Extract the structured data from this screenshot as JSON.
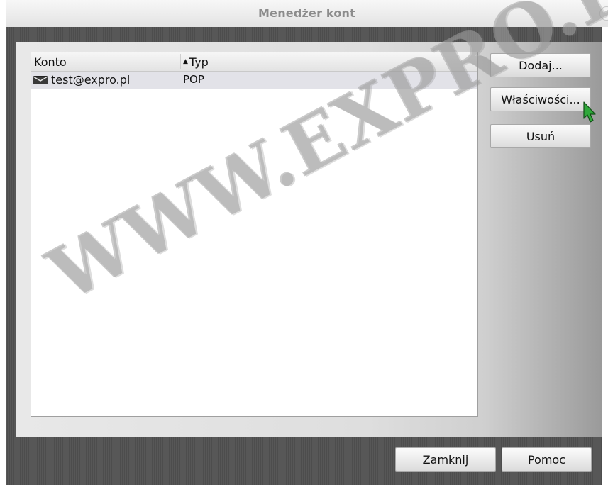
{
  "window": {
    "title": "Menedżer kont"
  },
  "list": {
    "columns": {
      "account": "Konto",
      "type": "Typ"
    },
    "rows": [
      {
        "account": "test@expro.pl",
        "type": "POP"
      }
    ]
  },
  "buttons": {
    "add": "Dodaj...",
    "properties": "Właściwości...",
    "remove": "Usuń",
    "close": "Zamknij",
    "help": "Pomoc"
  },
  "watermark": "WWW.EXPRO.PL",
  "icons": {
    "mail": "envelope-icon",
    "cursor": "mouse-pointer-icon",
    "sort": "sort-ascending-icon"
  },
  "colors": {
    "cursor": "#2fa83a",
    "frame": "#545454",
    "title": "#8c8c8c"
  }
}
